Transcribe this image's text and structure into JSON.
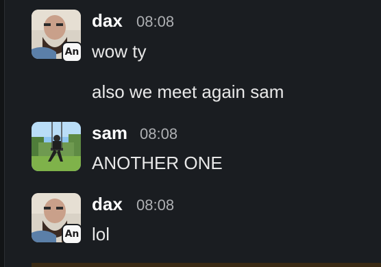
{
  "messages": [
    {
      "author": "dax",
      "time": "08:08",
      "badge": "An",
      "lines": [
        "wow ty",
        "also we meet again sam"
      ]
    },
    {
      "author": "sam",
      "time": "08:08",
      "lines": [
        "ANOTHER ONE"
      ]
    },
    {
      "author": "dax",
      "time": "08:08",
      "badge": "An",
      "lines": [
        "lol"
      ]
    }
  ],
  "icons": {
    "dax_avatar": "bearded-man-portrait",
    "sam_avatar": "person-on-swing-outdoors"
  }
}
